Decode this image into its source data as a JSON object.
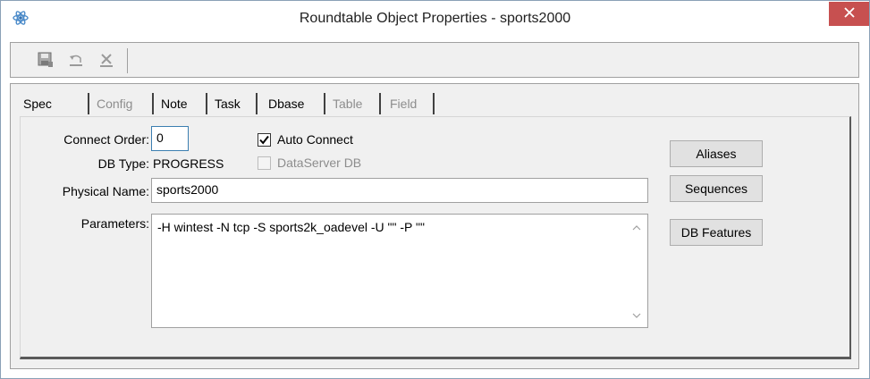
{
  "window": {
    "title": "Roundtable Object Properties - sports2000",
    "app_icon": "atom-icon",
    "close_icon": "close-icon"
  },
  "toolbar": {
    "buttons": [
      {
        "icon": "save-icon"
      },
      {
        "icon": "undo-icon"
      },
      {
        "icon": "delete-icon"
      }
    ]
  },
  "tabs": [
    {
      "label": "Spec",
      "enabled": true
    },
    {
      "label": "Config",
      "enabled": false
    },
    {
      "label": "Note",
      "enabled": true
    },
    {
      "label": "Task",
      "enabled": true
    },
    {
      "label": "Dbase",
      "enabled": true,
      "selected": true
    },
    {
      "label": "Table",
      "enabled": false
    },
    {
      "label": "Field",
      "enabled": false
    }
  ],
  "form": {
    "connect_order": {
      "label": "Connect Order:",
      "value": "0"
    },
    "auto_connect": {
      "label": "Auto Connect",
      "checked": true
    },
    "db_type": {
      "label": "DB Type:",
      "value": "PROGRESS"
    },
    "dataserver_db": {
      "label": "DataServer DB",
      "checked": false,
      "enabled": false
    },
    "physical_name": {
      "label": "Physical Name:",
      "value": "sports2000"
    },
    "parameters": {
      "label": "Parameters:",
      "value": "-H wintest -N tcp -S sports2k_oadevel -U \"\" -P \"\""
    }
  },
  "buttons": {
    "aliases": "Aliases",
    "sequences": "Sequences",
    "db_features": "DB Features"
  },
  "colors": {
    "close_button": "#c75050",
    "dialog_face": "#f0f0f0",
    "focus_border": "#3c7fb1"
  }
}
